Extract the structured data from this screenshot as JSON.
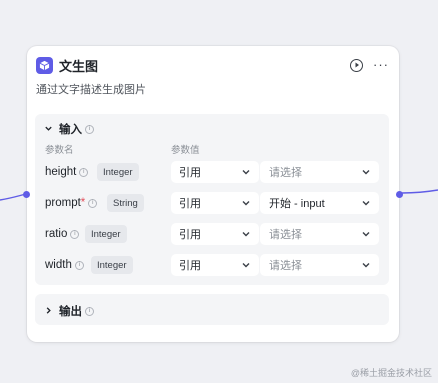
{
  "node": {
    "title": "文生图",
    "description": "通过文字描述生成图片",
    "icon": "image-icon",
    "accent_color": "#5f5ce6"
  },
  "input_section": {
    "label": "输入",
    "col_name": "参数名",
    "col_value": "参数值",
    "params": [
      {
        "name": "height",
        "required": "",
        "type": "Integer",
        "mode": "引用",
        "value": "请选择",
        "placeholder": true
      },
      {
        "name": "prompt",
        "required": "*",
        "type": "String",
        "mode": "引用",
        "value": "开始 - input",
        "placeholder": false
      },
      {
        "name": "ratio",
        "required": "",
        "type": "Integer",
        "mode": "引用",
        "value": "请选择",
        "placeholder": true
      },
      {
        "name": "width",
        "required": "",
        "type": "Integer",
        "mode": "引用",
        "value": "请选择",
        "placeholder": true
      }
    ]
  },
  "output_section": {
    "label": "输出"
  },
  "watermark": "@稀土掘金技术社区"
}
